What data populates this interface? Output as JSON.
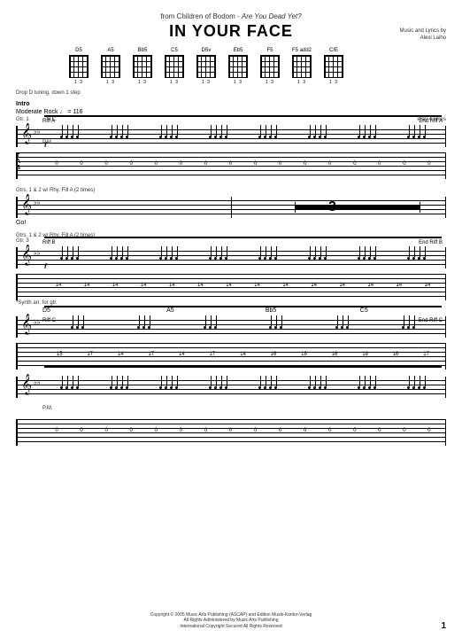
{
  "header": {
    "from_prefix": "from Children of Bodom - ",
    "album": "Are You Dead Yet?",
    "title": "IN YOUR FACE"
  },
  "credits": {
    "line1": "Music and Lyrics by",
    "line2": "Alexi Laiho"
  },
  "chords": [
    "D5",
    "A5",
    "Bb5",
    "C5",
    "D5v",
    "Eb5",
    "F5",
    "F5 add2",
    "C/E"
  ],
  "fret_info": "1 3",
  "tuning": "Drop D tuning, down 1 step",
  "section": "Intro",
  "tempo": "Moderate Rock ♩ = 116",
  "nc": "N.C.",
  "gtr1": "Gtr. 1",
  "gtrs12": "Gtrs. 1 & 2 w/ Rhy. Fill A (2 times)",
  "gtrs12b": "Gtrs. 1 & 2 w/ Rhy. Fill A (2 times)",
  "gtr3": "Gtr. 3",
  "lyric1": "Go!",
  "synth_note": "*Synth arr. for gtr.",
  "dyn_f": "f",
  "riff_a": "Riff A",
  "end_riff_a": "End Riff A",
  "riff_b": "Riff B",
  "end_riff_b": "End Riff B",
  "riff_c": "Riff C",
  "end_riff_c": "End Riff C",
  "pm": "P.M.",
  "rest_count": "3",
  "play_note": "Play 4 times",
  "tab_t": "T",
  "tab_a": "A",
  "tab_b": "B",
  "chord_over": {
    "d5": "D5",
    "a5": "A5",
    "bb5": "Bb5",
    "c5": "C5"
  },
  "tab_row1": [
    "0",
    "0",
    "0",
    "0",
    "0",
    "0",
    "0",
    "0",
    "0",
    "0",
    "0",
    "0",
    "0",
    "0",
    "0",
    "0"
  ],
  "tab_row2": [
    "14",
    "14",
    "14",
    "14",
    "14",
    "14",
    "14",
    "14",
    "14",
    "14",
    "14",
    "14",
    "14",
    "14"
  ],
  "tab_row3": [
    "15",
    "17",
    "14",
    "17",
    "14",
    "17",
    "14",
    "16",
    "18",
    "16",
    "18",
    "16",
    "17"
  ],
  "copyright": {
    "line1": "Copyright © 2005 Music Arts Publishing (ASCAP) and Edition Musik-Kontor-Verlag",
    "line2": "All Rights Administered by Music Arts Publishing",
    "line3": "International Copyright Secured   All Rights Reserved"
  },
  "page_num": "1"
}
